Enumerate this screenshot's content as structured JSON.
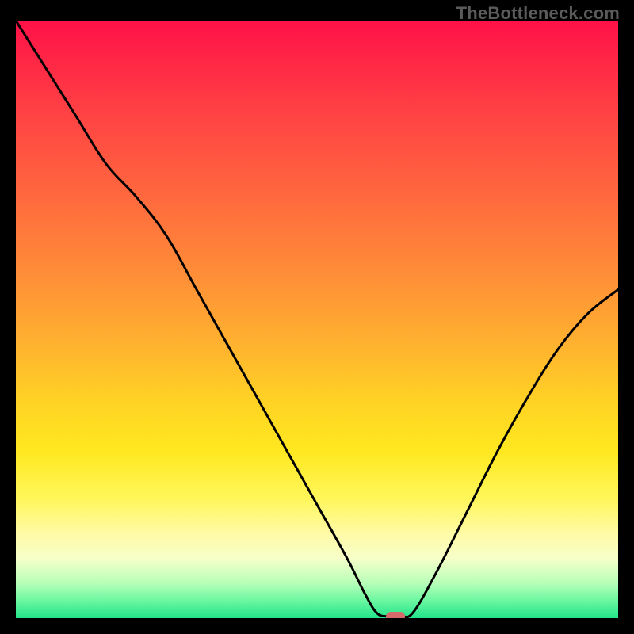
{
  "watermark": "TheBottleneck.com",
  "chart_data": {
    "type": "line",
    "title": "",
    "xlabel": "",
    "ylabel": "",
    "xlim": [
      0,
      100
    ],
    "ylim": [
      0,
      100
    ],
    "grid": false,
    "legend": false,
    "series": [
      {
        "name": "curve",
        "x": [
          0,
          5,
          10,
          15,
          20,
          25,
          30,
          35,
          40,
          45,
          50,
          55,
          58,
          60,
          62,
          64,
          66,
          70,
          75,
          80,
          85,
          90,
          95,
          100
        ],
        "y": [
          100,
          92,
          84,
          76,
          70.5,
          64,
          55,
          46,
          37,
          28,
          19,
          10,
          4,
          0.8,
          0.3,
          0.3,
          1.0,
          8,
          18,
          28,
          37,
          45,
          51,
          55
        ]
      }
    ],
    "marker": {
      "x": 63,
      "y": 0.3,
      "color": "#d46a6a"
    },
    "background": {
      "type": "vertical-gradient",
      "stops": [
        {
          "pos": 0,
          "color": "#ff1148"
        },
        {
          "pos": 18,
          "color": "#ff4943"
        },
        {
          "pos": 42,
          "color": "#ff8c38"
        },
        {
          "pos": 64,
          "color": "#ffd324"
        },
        {
          "pos": 86,
          "color": "#fffba8"
        },
        {
          "pos": 100,
          "color": "#21e58a"
        }
      ]
    }
  }
}
